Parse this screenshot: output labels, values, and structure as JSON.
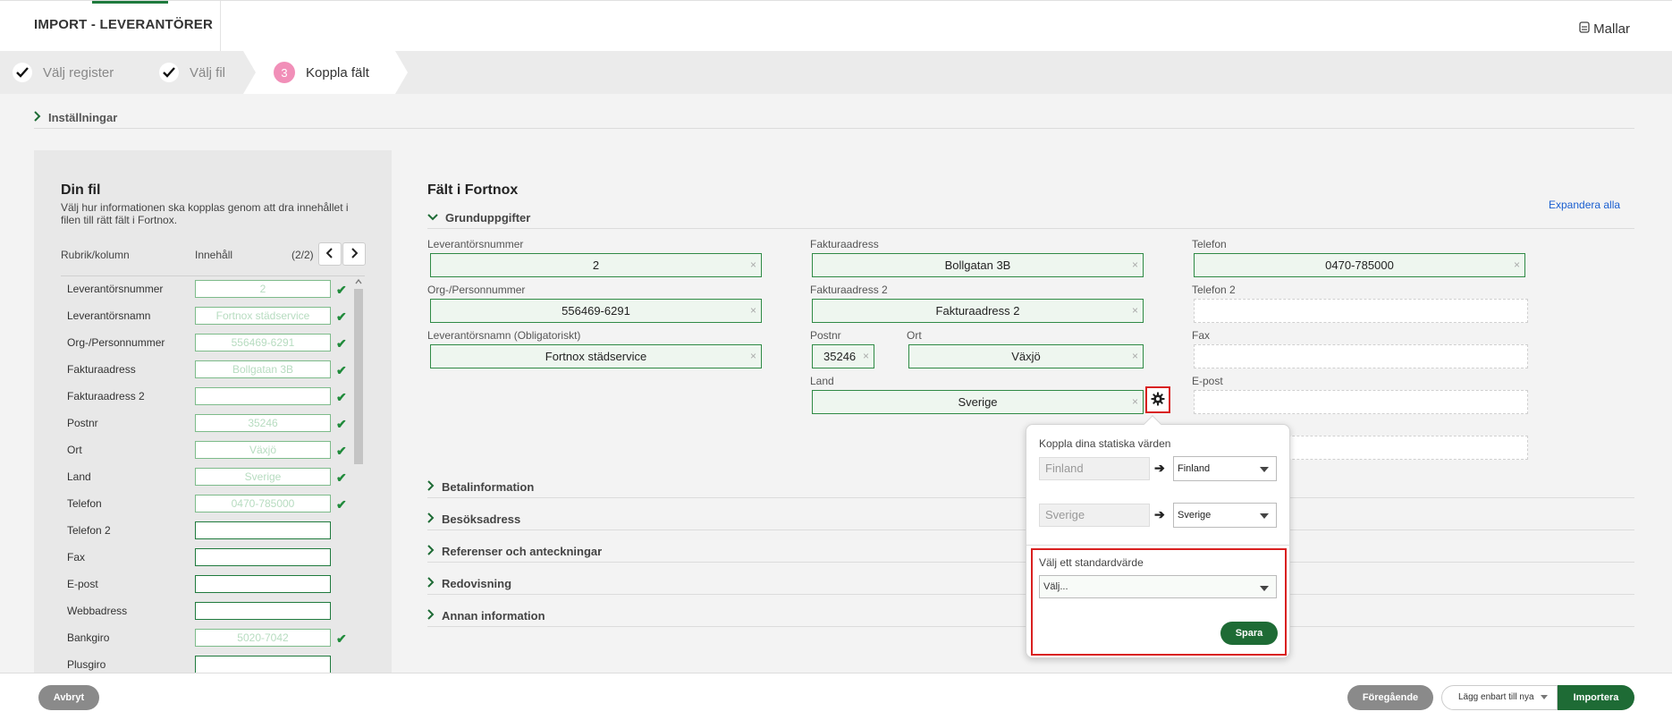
{
  "header": {
    "title": "IMPORT - LEVERANTÖRER",
    "templates_label": "Mallar"
  },
  "steps": [
    {
      "label": "Välj register"
    },
    {
      "label": "Välj fil"
    },
    {
      "number": "3",
      "label": "Koppla fält"
    }
  ],
  "settings_label": "Inställningar",
  "left": {
    "title": "Din fil",
    "description": "Välj hur informationen ska kopplas genom att dra innehållet i filen till rätt fält i Fortnox.",
    "col_header": "Rubrik/kolumn",
    "col_content": "Innehåll",
    "pagination": "(2/2)",
    "rows": [
      {
        "label": "Leverantörsnummer",
        "value": "2",
        "mapped": "✔"
      },
      {
        "label": "Leverantörsnamn",
        "value": "Fortnox städservice",
        "mapped": "✔"
      },
      {
        "label": "Org-/Personnummer",
        "value": "556469-6291",
        "mapped": "✔"
      },
      {
        "label": "Fakturaadress",
        "value": "Bollgatan 3B",
        "mapped": "✔"
      },
      {
        "label": "Fakturaadress 2",
        "value": "",
        "mapped": "✔"
      },
      {
        "label": "Postnr",
        "value": "35246",
        "mapped": "✔"
      },
      {
        "label": "Ort",
        "value": "Växjö",
        "mapped": "✔"
      },
      {
        "label": "Land",
        "value": "Sverige",
        "mapped": "✔"
      },
      {
        "label": "Telefon",
        "value": "0470-785000",
        "mapped": "✔"
      },
      {
        "label": "Telefon 2",
        "value": "",
        "mapped": ""
      },
      {
        "label": "Fax",
        "value": "",
        "mapped": ""
      },
      {
        "label": "E-post",
        "value": "",
        "mapped": ""
      },
      {
        "label": "Webbadress",
        "value": "",
        "mapped": ""
      },
      {
        "label": "Bankgiro",
        "value": "5020-7042",
        "mapped": "✔"
      },
      {
        "label": "Plusgiro",
        "value": "",
        "mapped": ""
      }
    ]
  },
  "main": {
    "title": "Fält i Fortnox",
    "expand_all": "Expandera alla",
    "section_main": "Grunduppgifter",
    "fields": {
      "supplier_number": {
        "label": "Leverantörsnummer",
        "value": "2"
      },
      "org_number": {
        "label": "Org-/Personnummer",
        "value": "556469-6291"
      },
      "supplier_name": {
        "label": "Leverantörsnamn (Obligatoriskt)",
        "value": "Fortnox städservice"
      },
      "invoice_address": {
        "label": "Fakturaadress",
        "value": "Bollgatan 3B"
      },
      "invoice_address2": {
        "label": "Fakturaadress 2",
        "value": "Fakturaadress 2"
      },
      "postal_code": {
        "label": "Postnr",
        "value": "35246"
      },
      "city": {
        "label": "Ort",
        "value": "Växjö"
      },
      "country": {
        "label": "Land",
        "value": "Sverige"
      },
      "phone": {
        "label": "Telefon",
        "value": "0470-785000"
      },
      "phone2": {
        "label": "Telefon 2"
      },
      "fax": {
        "label": "Fax"
      },
      "email": {
        "label": "E-post"
      }
    },
    "clear_glyph": "×",
    "sections": [
      "Betalinformation",
      "Besöksadress",
      "Referenser och anteckningar",
      "Redovisning",
      "Annan information"
    ]
  },
  "popover": {
    "title": "Koppla dina statiska värden",
    "mappings": [
      {
        "source": "Finland",
        "target": "Finland"
      },
      {
        "source": "Sverige",
        "target": "Sverige"
      }
    ],
    "default_label": "Välj ett standardvärde",
    "default_placeholder": "Välj...",
    "save_label": "Spara"
  },
  "footer": {
    "cancel_label": "Avbryt",
    "previous_label": "Föregående",
    "add_mode_label": "Lägg enbart till nya",
    "import_label": "Importera"
  },
  "colors": {
    "brand_green": "#1e6b35",
    "highlight_red": "#d92020",
    "step_pink": "#f18fb8"
  }
}
